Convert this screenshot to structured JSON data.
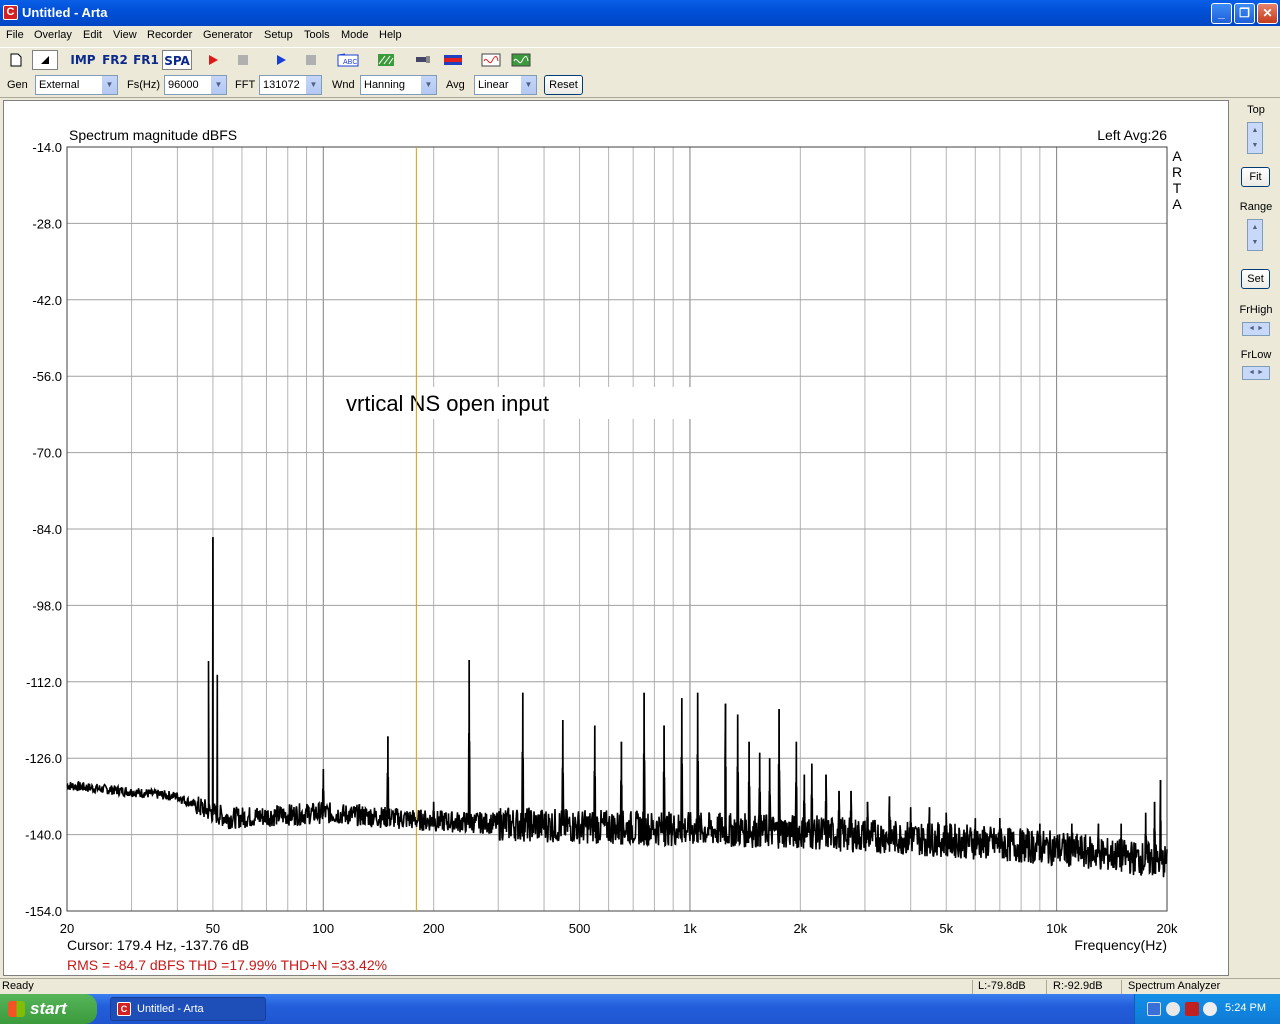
{
  "window": {
    "title": "Untitled - Arta",
    "minimize": "_",
    "maximize": "❐",
    "close": "✕"
  },
  "menu": [
    "File",
    "Overlay",
    "Edit",
    "View",
    "Recorder",
    "Generator",
    "Setup",
    "Tools",
    "Mode",
    "Help"
  ],
  "toolbar": {
    "imp": "IMP",
    "fr2": "FR2",
    "fr1": "FR1",
    "spa": "SPA"
  },
  "params": {
    "gen_label": "Gen",
    "gen_value": "External",
    "fs_label": "Fs(Hz)",
    "fs_value": "96000",
    "fft_label": "FFT",
    "fft_value": "131072",
    "wnd_label": "Wnd",
    "wnd_value": "Hanning",
    "avg_label": "Avg",
    "avg_value": "Linear",
    "reset": "Reset"
  },
  "side_panel": {
    "top": "Top",
    "fit": "Fit",
    "range": "Range",
    "set": "Set",
    "frhigh": "FrHigh",
    "frlow": "FrLow"
  },
  "chart_data": {
    "type": "line",
    "title": "Spectrum magnitude dBFS",
    "channel_info": "Left   Avg:26",
    "watermark": "A R T A",
    "annotation": "vrtical NS open input",
    "xlabel": "Frequency(Hz)",
    "x_scale": "log",
    "xlim": [
      20,
      20000
    ],
    "ylim": [
      -154,
      -14
    ],
    "y_ticks": [
      "-14.0",
      "-28.0",
      "-42.0",
      "-56.0",
      "-70.0",
      "-84.0",
      "-98.0",
      "-112.0",
      "-126.0",
      "-140.0",
      "-154.0"
    ],
    "y_tick_values": [
      -14,
      -28,
      -42,
      -56,
      -70,
      -84,
      -98,
      -112,
      -126,
      -140,
      -154
    ],
    "x_ticks": [
      "20",
      "50",
      "100",
      "200",
      "500",
      "1k",
      "2k",
      "5k",
      "10k",
      "20k"
    ],
    "x_tick_values": [
      20,
      50,
      100,
      200,
      500,
      1000,
      2000,
      5000,
      10000,
      20000
    ],
    "grid": true,
    "cursor_hz": 179.4,
    "cursor_text": "Cursor:   179.4 Hz, -137.76 dB",
    "stats_text": "RMS =  -84.7 dBFS   THD =17.99%   THD+N =33.42%",
    "series": [
      {
        "color": "#000000",
        "noise_floor": [
          [
            20,
            -131
          ],
          [
            40,
            -133
          ],
          [
            46,
            -135
          ],
          [
            55,
            -137
          ],
          [
            100,
            -136
          ],
          [
            200,
            -137.5
          ],
          [
            500,
            -138.5
          ],
          [
            1000,
            -139
          ],
          [
            2000,
            -139.5
          ],
          [
            5000,
            -141
          ],
          [
            10000,
            -142.5
          ],
          [
            20000,
            -145
          ]
        ],
        "peaks": [
          [
            50,
            -85.5
          ],
          [
            100,
            -128
          ],
          [
            150,
            -122
          ],
          [
            200,
            -134
          ],
          [
            250,
            -108
          ],
          [
            350,
            -114
          ],
          [
            450,
            -119
          ],
          [
            550,
            -120
          ],
          [
            650,
            -123
          ],
          [
            750,
            -114
          ],
          [
            850,
            -120
          ],
          [
            950,
            -115
          ],
          [
            1050,
            -114
          ],
          [
            1250,
            -116
          ],
          [
            1350,
            -118
          ],
          [
            1450,
            -123
          ],
          [
            1550,
            -125
          ],
          [
            1650,
            -126
          ],
          [
            1750,
            -117
          ],
          [
            1950,
            -123
          ],
          [
            2050,
            -129
          ],
          [
            2150,
            -127
          ],
          [
            2350,
            -129
          ],
          [
            2550,
            -132
          ],
          [
            2750,
            -132
          ],
          [
            3050,
            -134
          ],
          [
            3500,
            -133
          ],
          [
            4000,
            -135
          ],
          [
            4500,
            -135
          ],
          [
            5000,
            -136
          ],
          [
            6000,
            -137
          ],
          [
            7000,
            -137
          ],
          [
            9000,
            -138
          ],
          [
            11000,
            -138
          ],
          [
            13000,
            -138
          ],
          [
            15000,
            -138
          ],
          [
            17500,
            -136
          ],
          [
            18500,
            -134
          ],
          [
            19200,
            -130
          ]
        ]
      }
    ]
  },
  "status": {
    "ready": "Ready",
    "left_level": "L:-79.8dB",
    "right_level": "R:-92.9dB",
    "mode": "Spectrum Analyzer"
  },
  "taskbar": {
    "start": "start",
    "task_item": "Untitled - Arta",
    "clock": "5:24 PM"
  }
}
